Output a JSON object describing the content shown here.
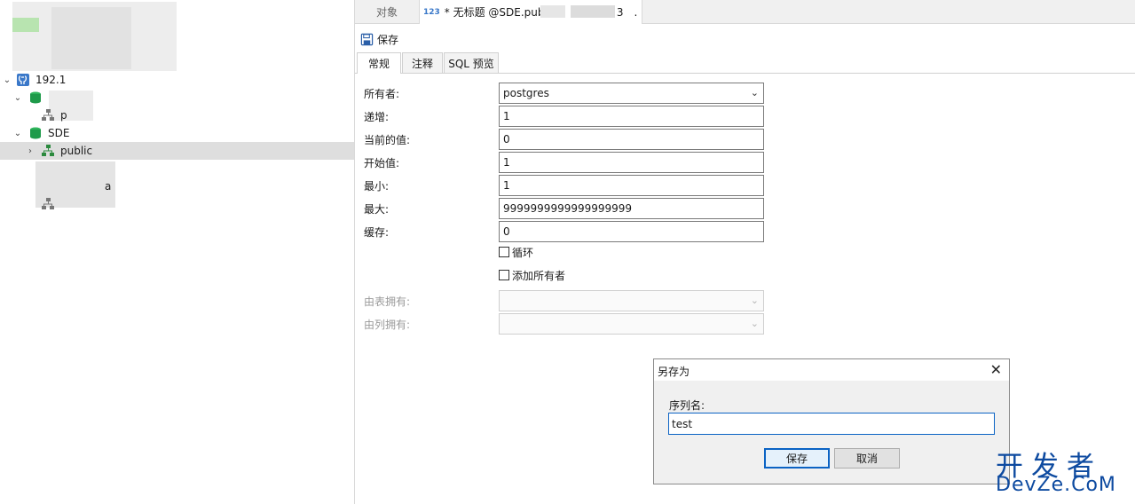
{
  "navigator": {
    "host_label": "192.1",
    "schema_partial_label": "p",
    "database_label": "SDE",
    "selected_schema_label": "public",
    "partial_text_1": "a"
  },
  "tabs": {
    "object_tab": "对象",
    "doc_tab_prefix": "* 无标题 @SDE.publ",
    "doc_tab_suffix": "3",
    "doc_tab_tail": ".",
    "doc_tab_icon": "123"
  },
  "toolbar": {
    "save_label": "保存",
    "save_icon": "save-icon"
  },
  "subtabs": [
    "常规",
    "注释",
    "SQL 预览"
  ],
  "form": {
    "owner_label": "所有者:",
    "owner_value": "postgres",
    "increment_label": "递增:",
    "increment_value": "1",
    "current_label": "当前的值:",
    "current_value": "0",
    "start_label": "开始值:",
    "start_value": "1",
    "min_label": "最小:",
    "min_value": "1",
    "max_label": "最大:",
    "max_value": "9999999999999999999",
    "cache_label": "缓存:",
    "cache_value": "0",
    "cycle_label": "循环",
    "add_owner_label": "添加所有者",
    "owned_by_table_label": "由表拥有:",
    "owned_by_column_label": "由列拥有:"
  },
  "dialog": {
    "title": "另存为",
    "close_glyph": "✕",
    "field_label": "序列名:",
    "field_value": "test",
    "ok_label": "保存",
    "cancel_label": "取消"
  },
  "watermark": {
    "line1": "开发者",
    "line2": "DevZe.CoM"
  },
  "colors": {
    "accent": "#0b63c4",
    "db_green": "#1e9a4a",
    "watermark": "#0d4aa0"
  }
}
